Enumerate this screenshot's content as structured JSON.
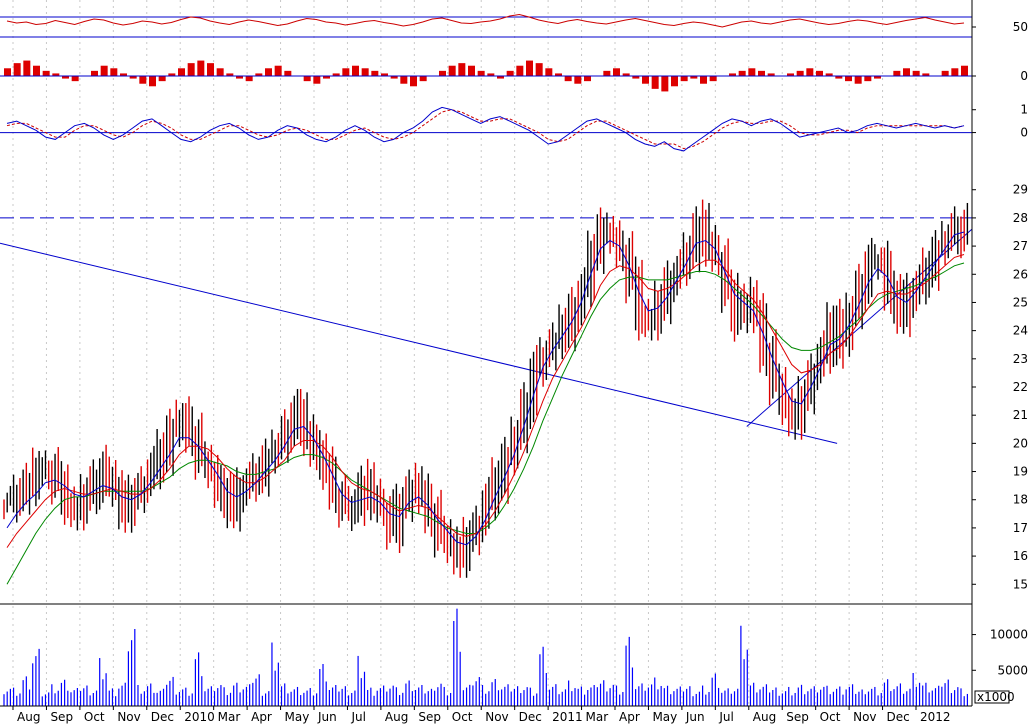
{
  "chart_data": [
    {
      "type": "line",
      "panel": "oscillator-1",
      "ylim": [
        0,
        100
      ],
      "y_ticks": [
        50
      ],
      "reference_lines": [
        70,
        30
      ],
      "colors": {
        "series": "#cc0000",
        "reference": "#0000cc"
      },
      "series": [
        {
          "values": [
            62,
            58,
            60,
            55,
            57,
            63,
            59,
            55,
            61,
            66,
            64,
            58,
            54,
            57,
            62,
            60,
            56,
            59,
            65,
            70,
            68,
            62,
            58,
            55,
            60,
            64,
            61,
            57,
            53,
            56,
            62,
            67,
            65,
            60,
            58,
            54,
            57,
            61,
            63,
            59,
            56,
            52,
            55,
            60,
            66,
            68,
            63,
            58,
            57,
            60,
            62,
            66,
            72,
            75,
            70,
            64,
            60,
            57,
            62,
            65,
            61,
            58,
            56,
            60,
            64,
            67,
            63,
            59,
            55,
            53,
            57,
            60,
            58,
            54,
            50,
            55,
            60,
            62,
            58,
            56,
            60,
            64,
            66,
            62,
            58,
            55,
            57,
            61,
            64,
            62,
            58,
            55,
            59,
            63,
            66,
            69,
            64,
            60,
            56,
            58
          ]
        }
      ]
    },
    {
      "type": "bar",
      "panel": "oscillator-2",
      "y_ticks": [
        0
      ],
      "colors": {
        "bars": "#dd0000",
        "zero": "#0000cc"
      },
      "values": [
        3,
        5,
        6,
        4,
        2,
        1,
        -1,
        -2,
        0,
        2,
        4,
        3,
        1,
        -1,
        -3,
        -4,
        -2,
        1,
        3,
        5,
        6,
        5,
        3,
        1,
        -1,
        -2,
        1,
        3,
        4,
        2,
        0,
        -2,
        -3,
        -1,
        1,
        3,
        4,
        3,
        2,
        1,
        -1,
        -3,
        -4,
        -2,
        0,
        2,
        4,
        5,
        4,
        2,
        1,
        -1,
        2,
        4,
        6,
        5,
        3,
        1,
        -2,
        -3,
        -2,
        0,
        2,
        3,
        1,
        -1,
        -3,
        -5,
        -6,
        -4,
        -2,
        -1,
        -3,
        -2,
        0,
        1,
        2,
        3,
        2,
        1,
        0,
        1,
        2,
        3,
        2,
        1,
        -1,
        -2,
        -3,
        -2,
        -1,
        0,
        2,
        3,
        2,
        1,
        0,
        2,
        3,
        4
      ]
    },
    {
      "type": "line",
      "panel": "oscillator-3",
      "ylim": [
        -1.2,
        1.6
      ],
      "y_ticks": [
        1,
        0
      ],
      "reference_lines": [
        0
      ],
      "colors": {
        "signal": "#0000cc",
        "trigger": "#cc0000"
      },
      "series": [
        {
          "values": [
            0.4,
            0.5,
            0.3,
            0.1,
            -0.2,
            -0.3,
            0.0,
            0.3,
            0.4,
            0.2,
            -0.1,
            -0.3,
            -0.1,
            0.2,
            0.5,
            0.6,
            0.3,
            0.0,
            -0.3,
            -0.4,
            -0.2,
            0.1,
            0.3,
            0.4,
            0.2,
            -0.1,
            -0.3,
            -0.2,
            0.1,
            0.3,
            0.2,
            -0.1,
            -0.3,
            -0.4,
            -0.2,
            0.1,
            0.3,
            0.1,
            -0.2,
            -0.4,
            -0.3,
            0.0,
            0.2,
            0.5,
            0.9,
            1.1,
            1.0,
            0.8,
            0.6,
            0.4,
            0.6,
            0.7,
            0.5,
            0.3,
            0.1,
            -0.2,
            -0.5,
            -0.4,
            -0.1,
            0.2,
            0.5,
            0.6,
            0.4,
            0.2,
            0.0,
            -0.3,
            -0.5,
            -0.6,
            -0.4,
            -0.7,
            -0.8,
            -0.5,
            -0.2,
            0.1,
            0.4,
            0.6,
            0.5,
            0.3,
            0.5,
            0.6,
            0.4,
            0.1,
            -0.2,
            -0.1,
            0.0,
            0.1,
            0.2,
            0.0,
            0.1,
            0.3,
            0.4,
            0.3,
            0.2,
            0.3,
            0.4,
            0.3,
            0.2,
            0.3,
            0.2,
            0.3
          ]
        },
        {
          "values": [
            0.3,
            0.4,
            0.4,
            0.2,
            0.0,
            -0.2,
            -0.2,
            0.1,
            0.3,
            0.3,
            0.1,
            -0.1,
            -0.2,
            0.0,
            0.3,
            0.5,
            0.4,
            0.2,
            -0.1,
            -0.3,
            -0.3,
            -0.1,
            0.1,
            0.3,
            0.3,
            0.1,
            -0.1,
            -0.2,
            -0.1,
            0.1,
            0.2,
            0.1,
            -0.1,
            -0.3,
            -0.3,
            -0.1,
            0.1,
            0.2,
            0.0,
            -0.2,
            -0.3,
            -0.2,
            0.0,
            0.3,
            0.6,
            0.9,
            1.0,
            0.9,
            0.7,
            0.5,
            0.5,
            0.6,
            0.6,
            0.4,
            0.2,
            0.0,
            -0.3,
            -0.4,
            -0.3,
            0.0,
            0.3,
            0.5,
            0.5,
            0.3,
            0.1,
            -0.1,
            -0.3,
            -0.5,
            -0.5,
            -0.5,
            -0.7,
            -0.6,
            -0.4,
            -0.1,
            0.2,
            0.4,
            0.5,
            0.4,
            0.4,
            0.5,
            0.5,
            0.3,
            0.0,
            -0.1,
            -0.1,
            0.0,
            0.1,
            0.1,
            0.0,
            0.2,
            0.3,
            0.3,
            0.3,
            0.3,
            0.3,
            0.3,
            0.3,
            0.3,
            0.2,
            0.3
          ]
        }
      ]
    },
    {
      "type": "line",
      "panel": "price",
      "ylim": [
        14.3,
        29.7
      ],
      "y_ticks": [
        15,
        16,
        17,
        18,
        19,
        20,
        21,
        22,
        23,
        24,
        25,
        26,
        27,
        28,
        29
      ],
      "x_labels": [
        "Aug",
        "Sep",
        "Oct",
        "Nov",
        "Dec",
        "2010",
        "Mar",
        "Apr",
        "May",
        "Jun",
        "Jul",
        "Aug",
        "Sep",
        "Oct",
        "Nov",
        "Dec",
        "2011",
        "Mar",
        "Apr",
        "May",
        "Jun",
        "Jul",
        "Aug",
        "Sep",
        "Oct",
        "Nov",
        "Dec",
        "2012"
      ],
      "resistance_level": 28.0,
      "trendlines": [
        {
          "from_label": "Aug",
          "from_value": 27.1,
          "to_label": "Nov",
          "to_value": 20.0
        },
        {
          "from_label": "Aug",
          "from_value": 20.6,
          "to_label": "2012",
          "to_value": 27.6
        }
      ],
      "colors": {
        "up": "#000000",
        "down": "#dd0000",
        "ma_short": "#0000cc",
        "ma_mid": "#dd0000",
        "ma_long": "#008800",
        "trendline": "#0000cc"
      },
      "close": [
        17.9,
        18.3,
        18.6,
        18.9,
        19.1,
        18.6,
        18.0,
        17.5,
        18.2,
        18.6,
        19.0,
        18.4,
        17.6,
        18.0,
        18.6,
        19.2,
        19.8,
        20.4,
        20.9,
        20.2,
        19.6,
        19.0,
        18.3,
        17.7,
        18.2,
        18.7,
        19.0,
        19.4,
        19.9,
        20.5,
        21.1,
        20.5,
        19.7,
        19.0,
        18.3,
        17.6,
        17.9,
        18.5,
        18.1,
        17.6,
        17.0,
        17.8,
        18.6,
        18.1,
        17.4,
        16.9,
        16.4,
        16.0,
        16.5,
        17.2,
        18.1,
        18.8,
        19.4,
        20.3,
        21.4,
        22.6,
        23.3,
        23.7,
        24.1,
        24.6,
        25.6,
        26.9,
        27.6,
        27.2,
        26.7,
        25.8,
        24.6,
        24.3,
        25.0,
        25.6,
        26.3,
        26.9,
        27.7,
        27.1,
        26.5,
        25.4,
        24.5,
        25.2,
        24.5,
        23.1,
        22.3,
        21.3,
        20.9,
        21.5,
        22.6,
        23.3,
        24.3,
        23.6,
        24.7,
        25.6,
        26.4,
        26.6,
        25.3,
        24.6,
        25.1,
        25.7,
        26.3,
        26.8,
        27.3,
        27.7,
        27.4
      ],
      "series": [
        {
          "name": "",
          "values": [
            17.0,
            17.5,
            17.9,
            18.2,
            18.6,
            18.7,
            18.5,
            18.2,
            18.1,
            18.3,
            18.5,
            18.4,
            18.1,
            18.0,
            18.2,
            18.6,
            19.1,
            19.6,
            20.2,
            20.2,
            19.9,
            19.4,
            18.9,
            18.3,
            18.1,
            18.3,
            18.6,
            19.0,
            19.4,
            19.9,
            20.5,
            20.6,
            20.2,
            19.6,
            18.9,
            18.2,
            17.9,
            18.0,
            18.1,
            17.9,
            17.5,
            17.4,
            17.9,
            18.1,
            17.8,
            17.3,
            16.9,
            16.5,
            16.4,
            16.7,
            17.3,
            18.1,
            18.8,
            19.6,
            20.6,
            21.7,
            22.7,
            23.3,
            23.8,
            24.3,
            25.0,
            26.0,
            26.9,
            27.2,
            27.0,
            26.3,
            25.4,
            24.7,
            24.8,
            25.2,
            25.8,
            26.4,
            27.1,
            27.2,
            26.9,
            26.1,
            25.3,
            25.0,
            24.7,
            23.9,
            23.0,
            22.2,
            21.5,
            21.4,
            22.0,
            22.7,
            23.5,
            23.7,
            24.2,
            24.9,
            25.7,
            26.2,
            25.9,
            25.2,
            25.0,
            25.4,
            25.9,
            26.4,
            26.9,
            27.4,
            27.5
          ]
        },
        {
          "name": "",
          "values": [
            16.3,
            16.8,
            17.2,
            17.6,
            18.0,
            18.3,
            18.4,
            18.3,
            18.2,
            18.2,
            18.3,
            18.4,
            18.3,
            18.2,
            18.2,
            18.4,
            18.7,
            19.1,
            19.6,
            19.9,
            19.9,
            19.8,
            19.5,
            19.1,
            18.8,
            18.6,
            18.6,
            18.8,
            19.1,
            19.4,
            19.9,
            20.1,
            20.1,
            19.9,
            19.5,
            19.0,
            18.6,
            18.4,
            18.3,
            18.1,
            17.8,
            17.6,
            17.7,
            17.8,
            17.7,
            17.4,
            17.1,
            16.8,
            16.7,
            16.8,
            17.1,
            17.6,
            18.2,
            18.9,
            19.7,
            20.6,
            21.5,
            22.3,
            22.9,
            23.5,
            24.1,
            24.8,
            25.6,
            26.1,
            26.3,
            26.2,
            25.9,
            25.5,
            25.4,
            25.5,
            25.7,
            26.0,
            26.3,
            26.5,
            26.5,
            26.2,
            25.7,
            25.4,
            25.1,
            24.6,
            24.0,
            23.4,
            22.8,
            22.5,
            22.6,
            22.8,
            23.2,
            23.4,
            23.8,
            24.3,
            24.8,
            25.3,
            25.4,
            25.3,
            25.3,
            25.5,
            25.7,
            26.0,
            26.3,
            26.6,
            26.7
          ]
        },
        {
          "name": "",
          "values": [
            15.0,
            15.6,
            16.2,
            16.8,
            17.3,
            17.7,
            18.0,
            18.1,
            18.1,
            18.2,
            18.3,
            18.3,
            18.3,
            18.3,
            18.3,
            18.4,
            18.6,
            18.8,
            19.1,
            19.3,
            19.4,
            19.4,
            19.3,
            19.2,
            19.0,
            18.9,
            18.9,
            19.0,
            19.1,
            19.3,
            19.5,
            19.6,
            19.6,
            19.5,
            19.3,
            19.0,
            18.7,
            18.5,
            18.3,
            18.1,
            17.9,
            17.7,
            17.6,
            17.5,
            17.4,
            17.2,
            17.0,
            16.9,
            16.8,
            16.8,
            17.0,
            17.3,
            17.8,
            18.4,
            19.1,
            19.9,
            20.8,
            21.6,
            22.4,
            23.1,
            23.8,
            24.5,
            25.1,
            25.5,
            25.8,
            25.9,
            25.9,
            25.8,
            25.8,
            25.8,
            25.9,
            26.0,
            26.1,
            26.1,
            26.0,
            25.8,
            25.5,
            25.2,
            24.9,
            24.5,
            24.1,
            23.7,
            23.4,
            23.3,
            23.3,
            23.4,
            23.6,
            23.8,
            24.1,
            24.4,
            24.8,
            25.1,
            25.3,
            25.4,
            25.5,
            25.6,
            25.8,
            25.9,
            26.1,
            26.3,
            26.4
          ]
        }
      ]
    },
    {
      "type": "bar",
      "panel": "volume",
      "unit_label": "x1000",
      "ylim": [
        0,
        14000
      ],
      "y_ticks": [
        5000,
        10000
      ],
      "colors": {
        "bars": "#0000ff"
      },
      "values": [
        3000,
        2600,
        4200,
        8100,
        2200,
        2900,
        3500,
        2400,
        3100,
        2700,
        6800,
        2500,
        3300,
        12500,
        2800,
        3000,
        2300,
        4400,
        2900,
        2600,
        7600,
        2800,
        3400,
        2500,
        3100,
        2900,
        4800,
        2600,
        9000,
        3200,
        2700,
        2500,
        2400,
        5600,
        2800,
        3000,
        2700,
        7100,
        2600,
        2900,
        3300,
        2500,
        3400,
        2800,
        2600,
        3900,
        2700,
        13800,
        3000,
        4700,
        2800,
        3600,
        2900,
        3000,
        3300,
        2600,
        8400,
        3100,
        2700,
        3400,
        2600,
        2800,
        3900,
        3700,
        2900,
        9800,
        3200,
        3500,
        3800,
        2700,
        2600,
        3000,
        2500,
        2900,
        4600,
        2500,
        2800,
        10700,
        3100,
        2900,
        2800,
        2600,
        2700,
        3000,
        2800,
        3100,
        2700,
        2600,
        2900,
        2500,
        3000,
        2700,
        3800,
        3200,
        2800,
        4400,
        3100,
        2700,
        4000,
        3300,
        2500
      ]
    }
  ]
}
